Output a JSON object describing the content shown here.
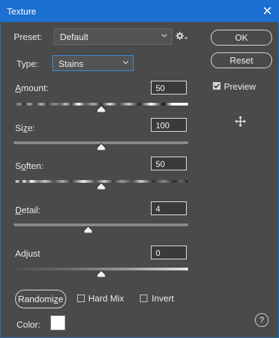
{
  "window": {
    "title": "Texture",
    "close_glyph": "✕"
  },
  "preset": {
    "label": "Preset:",
    "value": "Default",
    "gear_icon": "gear-icon",
    "chevron_icon": "chevron-down-icon"
  },
  "type": {
    "label": "Type:",
    "value": "Stains",
    "chevron_icon": "chevron-down-icon"
  },
  "buttons": {
    "ok": "OK",
    "reset": "Reset",
    "randomize": "Randomize"
  },
  "preview": {
    "label": "Preview",
    "checked": true
  },
  "move_icon": "move-icon",
  "sliders": [
    {
      "label": "Amount:",
      "value": "50",
      "level_percent": 50
    },
    {
      "label": "Size:",
      "value": "100",
      "level_percent": 50
    },
    {
      "label": "Soften:",
      "value": "50",
      "level_percent": 50
    },
    {
      "label": "Detail:",
      "value": "4",
      "level_percent": 43
    },
    {
      "label": "Adjust",
      "value": "0",
      "level_percent": 50
    }
  ],
  "checkboxes": {
    "hard_mix": {
      "label": "Hard Mix",
      "checked": false
    },
    "invert": {
      "label": "Invert",
      "checked": false
    }
  },
  "color": {
    "label": "Color:",
    "hex": "#ffffff"
  },
  "help": {
    "glyph": "?"
  }
}
